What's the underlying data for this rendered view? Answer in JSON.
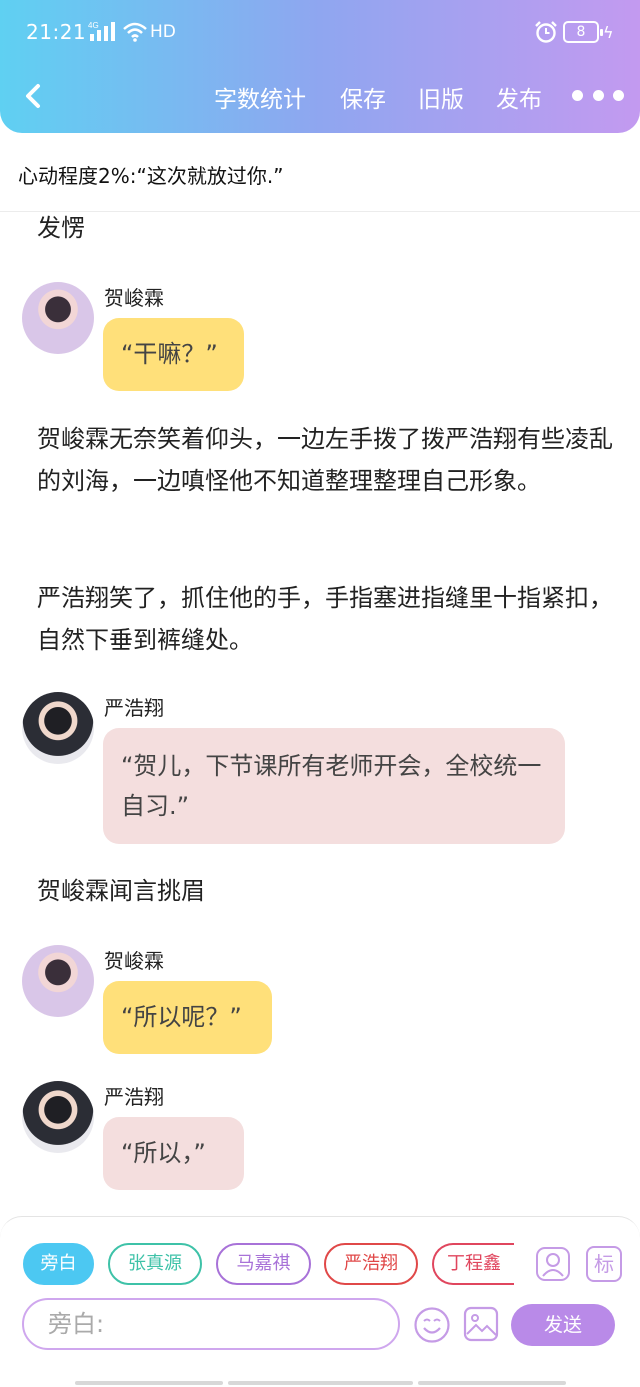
{
  "status_bar": {
    "time": "21:21",
    "network": "HD",
    "battery": "8"
  },
  "header": {
    "nav": [
      "字数统计",
      "保存",
      "旧版",
      "发布"
    ]
  },
  "subtitle": "心动程度2%:“这次就放过你.”",
  "story": {
    "narr1": "发愣",
    "msg1": {
      "name": "贺峻霖",
      "text": "“干嘛？”"
    },
    "narr2": "贺峻霖无奈笑着仰头，一边左手拨了拨严浩翔有些凌乱的刘海，一边嗔怪他不知道整理整理自己形象。",
    "narr3": "严浩翔笑了，抓住他的手，手指塞进指缝里十指紧扣，自然下垂到裤缝处。",
    "msg2": {
      "name": "严浩翔",
      "text": "“贺儿，下节课所有老师开会，全校统一自习.”"
    },
    "narr4": "贺峻霖闻言挑眉",
    "msg3": {
      "name": "贺峻霖",
      "text": "“所以呢？”"
    },
    "msg4": {
      "name": "严浩翔",
      "text": "“所以，”"
    }
  },
  "composer": {
    "chips": [
      "旁白",
      "张真源",
      "马嘉祺",
      "严浩翔",
      "丁程鑫"
    ],
    "mark_label": "标",
    "input_placeholder": "旁白:",
    "send_label": "发送"
  }
}
